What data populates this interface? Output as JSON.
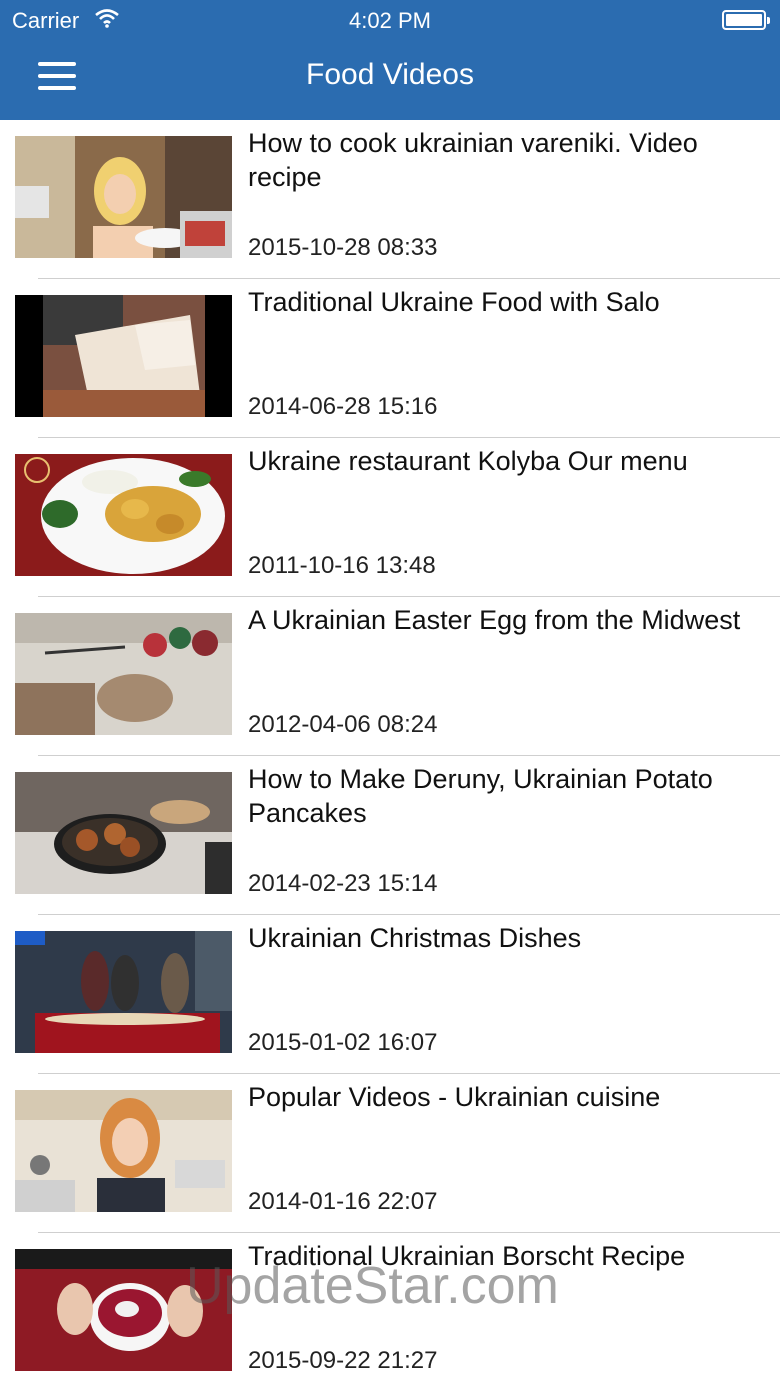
{
  "status_bar": {
    "carrier": "Carrier",
    "time": "4:02 PM"
  },
  "header": {
    "title": "Food Videos",
    "menu_icon": "hamburger-menu-icon",
    "background": "#2b6cb0"
  },
  "videos": [
    {
      "title": "How to cook ukrainian vareniki. Video recipe",
      "date": "2015-10-28 08:33"
    },
    {
      "title": "Traditional Ukraine Food with Salo",
      "date": "2014-06-28 15:16"
    },
    {
      "title": "Ukraine restaurant Kolyba Our menu",
      "date": "2011-10-16 13:48"
    },
    {
      "title": "A Ukrainian Easter Egg from the Midwest",
      "date": "2012-04-06 08:24"
    },
    {
      "title": "How to Make Deruny, Ukrainian Potato Pancakes",
      "date": "2014-02-23 15:14"
    },
    {
      "title": "Ukrainian Christmas Dishes",
      "date": "2015-01-02 16:07"
    },
    {
      "title": "Popular Videos - Ukrainian cuisine",
      "date": "2014-01-16 22:07"
    },
    {
      "title": "Traditional Ukrainian Borscht Recipe",
      "date": "2015-09-22 21:27"
    }
  ],
  "watermark": "UpdateStar.com"
}
